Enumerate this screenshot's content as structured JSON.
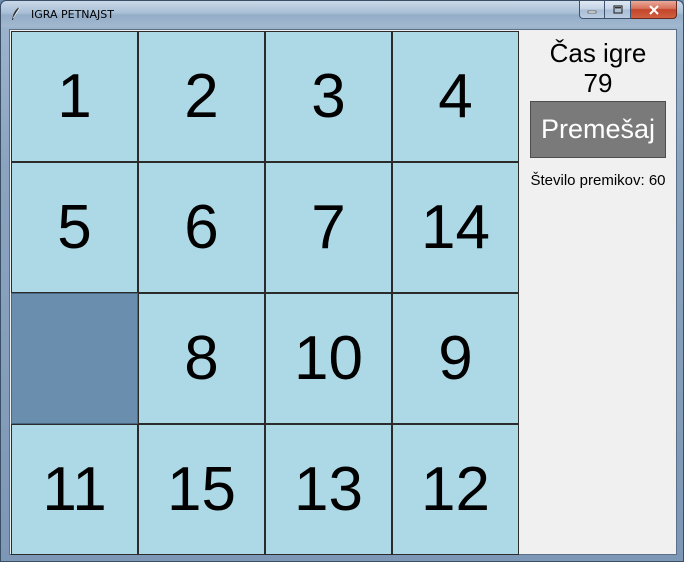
{
  "window": {
    "title": "IGRA PETNAJST"
  },
  "board": {
    "tiles": [
      "1",
      "2",
      "3",
      "4",
      "5",
      "6",
      "7",
      "14",
      "",
      "8",
      "10",
      "9",
      "11",
      "15",
      "13",
      "12"
    ],
    "tile_color": "#add8e6",
    "empty_color": "#6a8fae"
  },
  "sidebar": {
    "time_label": "Čas igre",
    "time_value": "79",
    "shuffle_label": "Premešaj",
    "moves_text": "Število premikov: 60"
  }
}
